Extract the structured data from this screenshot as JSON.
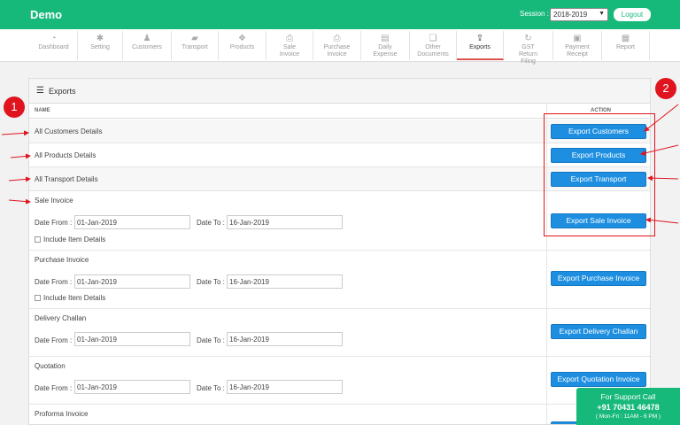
{
  "header": {
    "brand": "Demo",
    "session_label": "Session :",
    "session_value": "2018-2019",
    "logout": "Logout"
  },
  "nav": [
    {
      "label": "Dashboard",
      "icon": "dashboard-icon",
      "glyph": "◔"
    },
    {
      "label": "Setting",
      "icon": "gear-icon",
      "glyph": "✱"
    },
    {
      "label": "Customers",
      "icon": "users-icon",
      "glyph": "♟"
    },
    {
      "label": "Transport",
      "icon": "truck-icon",
      "glyph": "▰"
    },
    {
      "label": "Products",
      "icon": "cubes-icon",
      "glyph": "❖"
    },
    {
      "label": "Sale Invoice",
      "icon": "printer-icon",
      "glyph": "⎙"
    },
    {
      "label": "Purchase Invoice",
      "icon": "printer-icon",
      "glyph": "⎙"
    },
    {
      "label": "Daily Expense",
      "icon": "list-icon",
      "glyph": "▤"
    },
    {
      "label": "Other Documents",
      "icon": "documents-icon",
      "glyph": "❏"
    },
    {
      "label": "Exports",
      "icon": "upload-icon",
      "glyph": "⇪"
    },
    {
      "label": "GST Return Filing",
      "icon": "refresh-icon",
      "glyph": "↻"
    },
    {
      "label": "Payment Receipt",
      "icon": "money-icon",
      "glyph": "▣"
    },
    {
      "label": "Report",
      "icon": "report-icon",
      "glyph": "▦"
    }
  ],
  "panel": {
    "title": "Exports",
    "col_name": "NAME",
    "col_action": "ACTION"
  },
  "rows": [
    {
      "label": "All Customers Details",
      "button": "Export Customers"
    },
    {
      "label": "All Products Details",
      "button": "Export Products"
    },
    {
      "label": "All Transport Details",
      "button": "Export Transport"
    },
    {
      "label": "Sale Invoice",
      "button": "Export Sale Invoice",
      "date_from": "01-Jan-2019",
      "date_to": "16-Jan-2019",
      "include": "Include Item Details"
    },
    {
      "label": "Purchase Invoice",
      "button": "Export Purchase Invoice",
      "date_from": "01-Jan-2019",
      "date_to": "16-Jan-2019",
      "include": "Include Item Details"
    },
    {
      "label": "Delivery Challan",
      "button": "Export Delivery Challan",
      "date_from": "01-Jan-2019",
      "date_to": "16-Jan-2019"
    },
    {
      "label": "Quotation",
      "button": "Export Quotation Invoice",
      "date_from": "01-Jan-2019",
      "date_to": "16-Jan-2019"
    },
    {
      "label": "Proforma Invoice"
    }
  ],
  "date_from_label": "Date From :",
  "date_to_label": "Date To :",
  "annotations": {
    "badge1": "1",
    "badge2": "2",
    "color": "#e0141e"
  },
  "support": {
    "title": "For Support Call",
    "phone": "+91 70431 46478",
    "hours": "( Mon-Fri : 11AM - 6 PM )"
  },
  "colors": {
    "brand": "#17b97b",
    "button": "#1e8fe0"
  }
}
